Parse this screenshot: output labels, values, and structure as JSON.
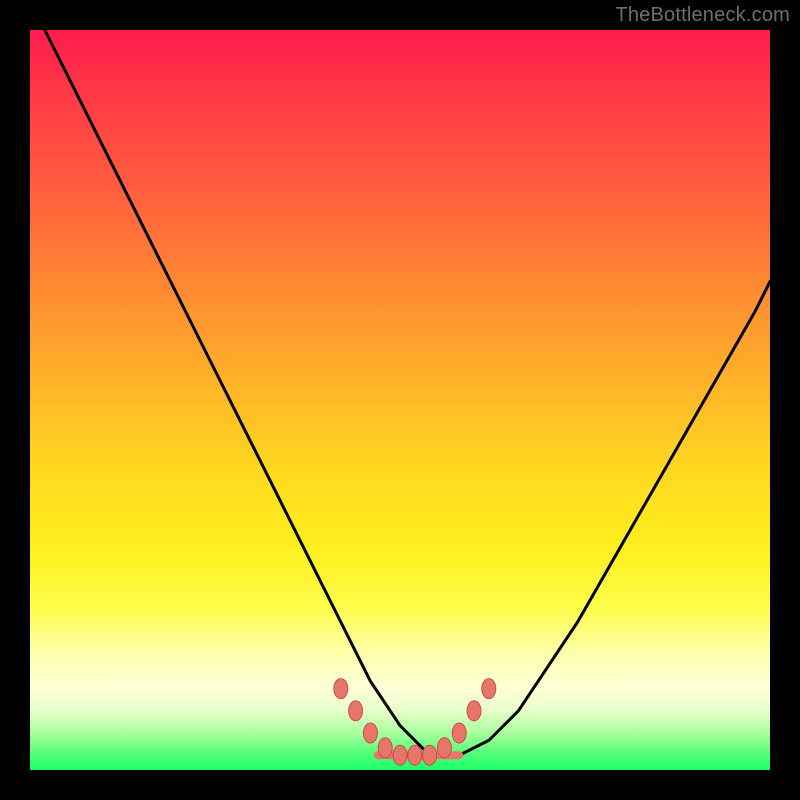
{
  "watermark": "TheBottleneck.com",
  "chart_data": {
    "type": "line",
    "title": "",
    "xlabel": "",
    "ylabel": "",
    "xlim": [
      0,
      100
    ],
    "ylim": [
      0,
      100
    ],
    "grid": false,
    "series": [
      {
        "name": "curve",
        "x": [
          2,
          6,
          10,
          14,
          18,
          22,
          26,
          30,
          34,
          38,
          42,
          46,
          50,
          54,
          58,
          62,
          66,
          70,
          74,
          78,
          82,
          86,
          90,
          94,
          98,
          100
        ],
        "y": [
          100,
          92,
          84,
          76,
          68,
          60,
          52,
          44,
          36,
          28,
          20,
          12,
          6,
          2,
          2,
          4,
          8,
          14,
          20,
          27,
          34,
          41,
          48,
          55,
          62,
          66
        ]
      }
    ],
    "markers": {
      "name": "bottleneck-band",
      "x": [
        42,
        44,
        46,
        48,
        50,
        52,
        54,
        56,
        58,
        60,
        62
      ],
      "y": [
        11,
        8,
        5,
        3,
        2,
        2,
        2,
        3,
        5,
        8,
        11
      ]
    },
    "gradient_bands": [
      {
        "color": "#ff1b4e",
        "from": 100,
        "to": 80
      },
      {
        "color": "#ff8a32",
        "from": 80,
        "to": 55
      },
      {
        "color": "#ffd91f",
        "from": 55,
        "to": 30
      },
      {
        "color": "#feffa8",
        "from": 30,
        "to": 12
      },
      {
        "color": "#1cff66",
        "from": 12,
        "to": 0
      }
    ]
  }
}
